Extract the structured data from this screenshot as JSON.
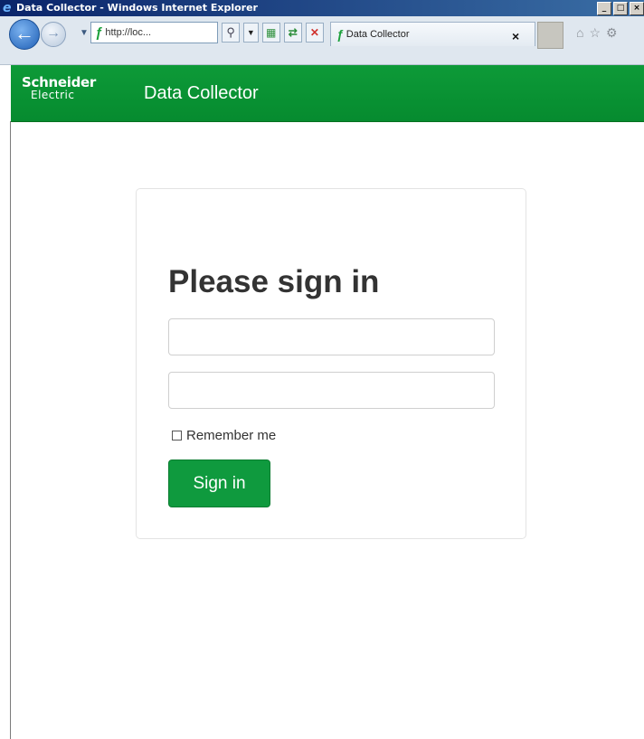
{
  "window": {
    "title": "Data Collector - Windows Internet Explorer",
    "controls": {
      "minimize": "_",
      "maximize": "□",
      "close": "×"
    }
  },
  "browser": {
    "address": "http://loc...",
    "tab_title": "Data Collector",
    "tab_close": "×"
  },
  "app": {
    "brand_line1": "Schneider",
    "brand_line2": "Electric",
    "title": "Data Collector"
  },
  "login": {
    "heading": "Please sign in",
    "username_placeholder": "",
    "password_placeholder": "",
    "remember_label": "Remember me",
    "remember_checked": false,
    "submit_label": "Sign in"
  },
  "colors": {
    "brand_green": "#0d9a38",
    "button_green": "#0f9a3e",
    "titlebar_blue": "#0a246a"
  }
}
